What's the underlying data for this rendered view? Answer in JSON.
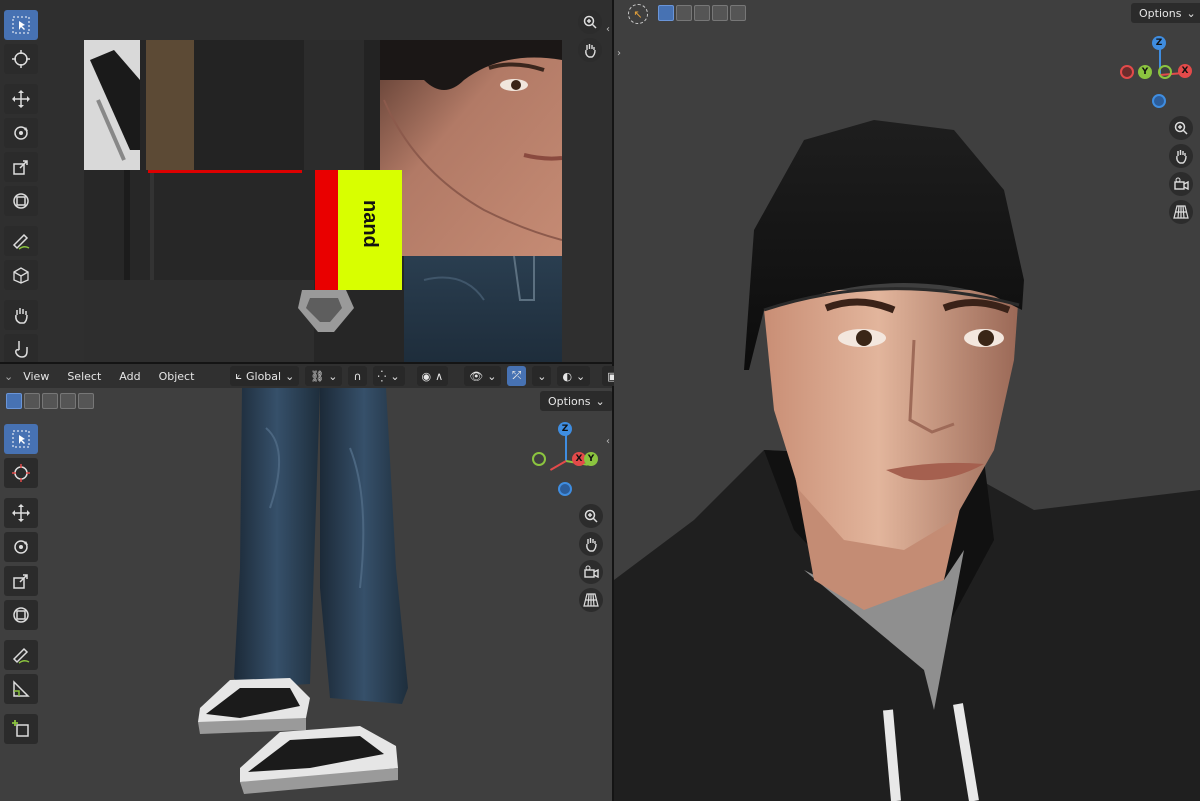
{
  "vp1_header": {
    "menus": [
      "View",
      "Select",
      "Add",
      "Object"
    ],
    "transform_orientation": "Global"
  },
  "vp1": {
    "options_label": "Options"
  },
  "vp2": {
    "options_label": "Options"
  },
  "texture": {
    "decal_text": "nand"
  },
  "gizmo": {
    "z": "Z",
    "x": "X",
    "y": "Y"
  },
  "colors": {
    "accent": "#4772b3",
    "axis_x": "#e34a4a",
    "axis_y": "#8bc43f",
    "axis_z": "#3f8de0",
    "panel": "#2b2b2b",
    "viewport": "#3f3f3f"
  }
}
